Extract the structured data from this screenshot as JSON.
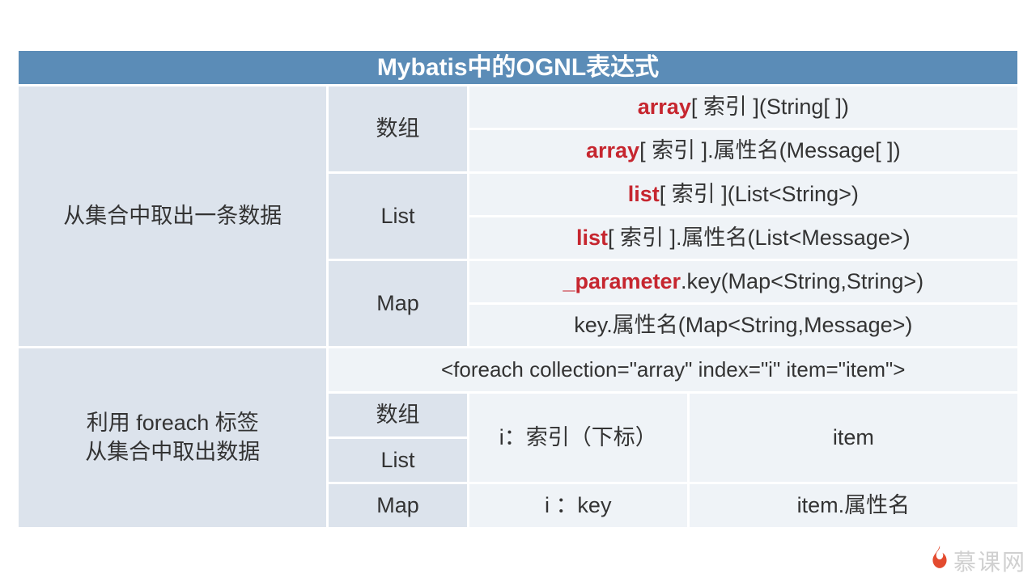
{
  "header": "Mybatis中的OGNL表达式",
  "section1": {
    "title": "从集合中取出一条数据",
    "groups": [
      {
        "label": "数组",
        "rows": [
          {
            "kw": "array",
            "rest": "[ 索引 ](String[ ])"
          },
          {
            "kw": "array",
            "rest": "[ 索引 ].属性名(Message[ ])"
          }
        ]
      },
      {
        "label": "List",
        "rows": [
          {
            "kw": "list",
            "rest": "[ 索引 ](List<String>)"
          },
          {
            "kw": "list",
            "rest": "[ 索引 ].属性名(List<Message>)"
          }
        ]
      },
      {
        "label": "Map",
        "rows": [
          {
            "kw": "_parameter",
            "rest": ".key(Map<String,String>)"
          },
          {
            "kw": "",
            "rest": "key.属性名(Map<String,Message>)"
          }
        ]
      }
    ]
  },
  "section2": {
    "title1": "利用 foreach 标签",
    "title2": "从集合中取出数据",
    "code": "<foreach collection=\"array\" index=\"i\" item=\"item\">",
    "labels": {
      "arr": "数组",
      "list": "List",
      "map": "Map"
    },
    "i_idx": "i：索引（下标）",
    "i_key": "i ：key",
    "item1": "item",
    "item2": "item.属性名"
  },
  "brand": "慕课网"
}
